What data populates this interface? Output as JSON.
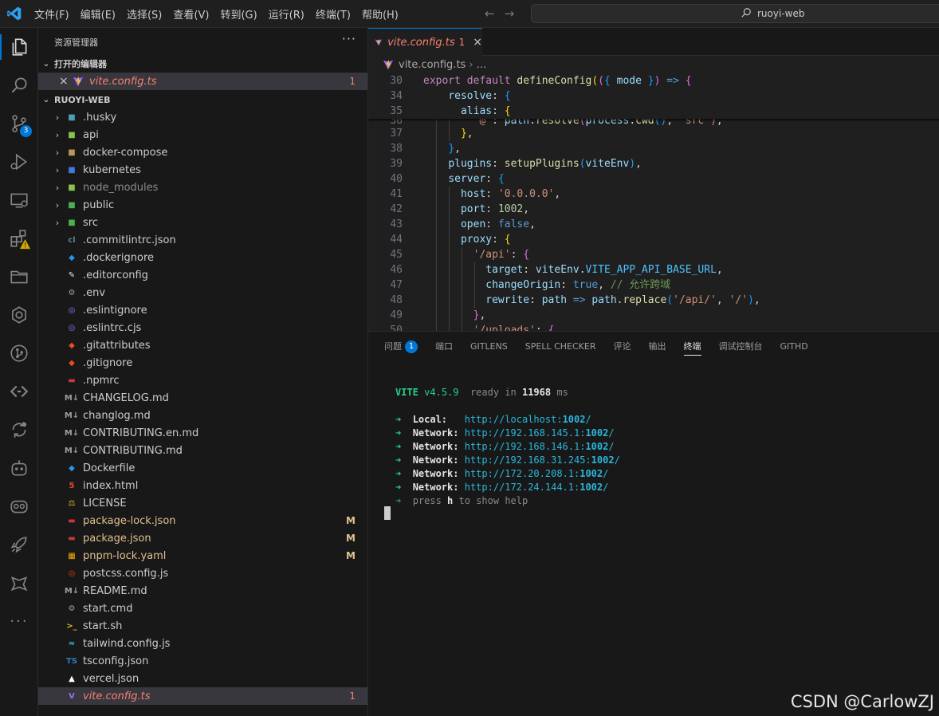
{
  "titlebar": {
    "menu": [
      "文件(F)",
      "编辑(E)",
      "选择(S)",
      "查看(V)",
      "转到(G)",
      "运行(R)",
      "终端(T)",
      "帮助(H)"
    ],
    "search_text": "ruoyi-web",
    "logo_icon": "vscode-logo-icon",
    "back_icon": "arrow-left-icon",
    "forward_icon": "arrow-right-icon"
  },
  "activity_bar": {
    "items": [
      "explorer-icon",
      "search-icon",
      "source-control-icon",
      "run-debug-icon",
      "remote-explorer-icon",
      "extensions-icon",
      "folder-icon",
      "openai-icon",
      "git-graph-icon",
      "code-brackets-icon",
      "sync-icon",
      "copilot-icon",
      "github-icon",
      "rocket-icon",
      "puzzle-icon",
      "more-icon"
    ],
    "source_control_badge": "3"
  },
  "sidebar": {
    "title": "资源管理器",
    "more": "···",
    "open_editors_header": "打开的编辑器",
    "open_editor": {
      "name": "vite.config.ts",
      "badge": "1"
    },
    "project_header": "RUOYI-WEB",
    "items": [
      {
        "name": ".husky",
        "type": "folder"
      },
      {
        "name": "api",
        "type": "folder"
      },
      {
        "name": "docker-compose",
        "type": "folder"
      },
      {
        "name": "kubernetes",
        "type": "folder"
      },
      {
        "name": "node_modules",
        "type": "folder"
      },
      {
        "name": "public",
        "type": "folder"
      },
      {
        "name": "src",
        "type": "folder"
      },
      {
        "name": ".commitlintrc.json",
        "type": "file"
      },
      {
        "name": ".dockerignore",
        "type": "file"
      },
      {
        "name": ".editorconfig",
        "type": "file"
      },
      {
        "name": ".env",
        "type": "file"
      },
      {
        "name": ".eslintignore",
        "type": "file"
      },
      {
        "name": ".eslintrc.cjs",
        "type": "file"
      },
      {
        "name": ".gitattributes",
        "type": "file"
      },
      {
        "name": ".gitignore",
        "type": "file"
      },
      {
        "name": ".npmrc",
        "type": "file"
      },
      {
        "name": "CHANGELOG.md",
        "type": "file"
      },
      {
        "name": "changlog.md",
        "type": "file"
      },
      {
        "name": "CONTRIBUTING.en.md",
        "type": "file"
      },
      {
        "name": "CONTRIBUTING.md",
        "type": "file"
      },
      {
        "name": "Dockerfile",
        "type": "file"
      },
      {
        "name": "index.html",
        "type": "file"
      },
      {
        "name": "LICENSE",
        "type": "file"
      },
      {
        "name": "package-lock.json",
        "type": "file",
        "badge": "M"
      },
      {
        "name": "package.json",
        "type": "file",
        "badge": "M"
      },
      {
        "name": "pnpm-lock.yaml",
        "type": "file",
        "badge": "M"
      },
      {
        "name": "postcss.config.js",
        "type": "file"
      },
      {
        "name": "README.md",
        "type": "file"
      },
      {
        "name": "start.cmd",
        "type": "file"
      },
      {
        "name": "start.sh",
        "type": "file"
      },
      {
        "name": "tailwind.config.js",
        "type": "file"
      },
      {
        "name": "tsconfig.json",
        "type": "file"
      },
      {
        "name": "vercel.json",
        "type": "file"
      },
      {
        "name": "vite.config.ts",
        "type": "file",
        "badge": "1"
      }
    ]
  },
  "editor": {
    "tab": {
      "label": "vite.config.ts",
      "count": "1",
      "close": "×"
    },
    "breadcrumb": [
      "vite.config.ts",
      "…"
    ],
    "line_numbers": [
      "30",
      "34",
      "35",
      "36",
      "37",
      "38",
      "39",
      "40",
      "41",
      "42",
      "43",
      "44",
      "45",
      "46",
      "47",
      "48",
      "49",
      "50"
    ]
  },
  "panel": {
    "tabs": [
      "问题",
      "端口",
      "GITLENS",
      "SPELL CHECKER",
      "评论",
      "输出",
      "终端",
      "调试控制台",
      "GITHD"
    ],
    "problems_badge": "1",
    "active_tab": "终端",
    "terminal": {
      "vite": "VITE",
      "version": "v4.5.9",
      "ready": "ready in",
      "time": "11968",
      "unit": "ms",
      "arrow": "➜",
      "local_label": "Local:",
      "network_label": "Network:",
      "local_url": [
        "http://localhost:",
        "1002",
        "/"
      ],
      "network_urls": [
        [
          "http://192.168.145.1:",
          "1002",
          "/"
        ],
        [
          "http://192.168.146.1:",
          "1002",
          "/"
        ],
        [
          "http://192.168.31.245:",
          "1002",
          "/"
        ],
        [
          "http://172.20.208.1:",
          "1002",
          "/"
        ],
        [
          "http://172.24.144.1:",
          "1002",
          "/"
        ]
      ],
      "help": [
        "press",
        "h",
        "to show help"
      ]
    }
  },
  "watermark": "CSDN @CarlowZJ"
}
